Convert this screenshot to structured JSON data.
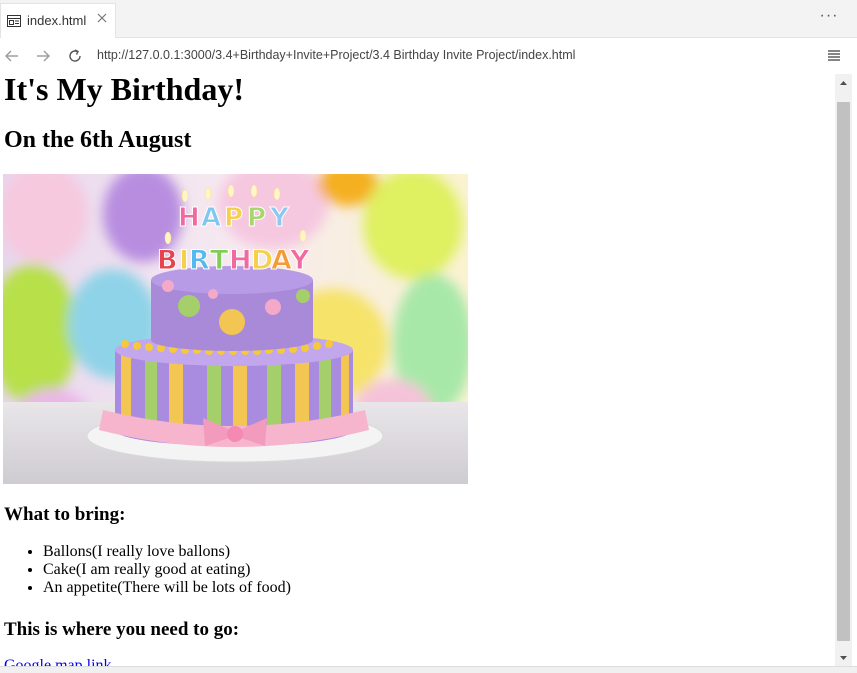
{
  "tab": {
    "title": "index.html",
    "file_icon": "browser-file-icon",
    "close_icon": "close-icon"
  },
  "toolbar": {
    "more_label": "···"
  },
  "nav": {
    "back_icon": "arrow-left-icon",
    "forward_icon": "arrow-right-icon",
    "reload_icon": "reload-icon",
    "url": "http://127.0.0.1:3000/3.4+Birthday+Invite+Project/3.4 Birthday Invite Project/index.html",
    "menu_icon": "hamburger-menu-icon"
  },
  "page": {
    "title": "It's My Birthday!",
    "date": "On the 6th August",
    "hero_image": "birthday-cake-image",
    "bring_heading": "What to bring:",
    "bring_items": [
      "Ballons(I really love ballons)",
      "Cake(I am really good at eating)",
      "An appetite(There will be lots of food)"
    ],
    "where_heading": "This is where you need to go:",
    "map_link": "Google map link"
  },
  "colors": {
    "link": "#0000ee",
    "tab_bar_bg": "#f3f3f3",
    "scroll_thumb": "#c1c1c1"
  }
}
